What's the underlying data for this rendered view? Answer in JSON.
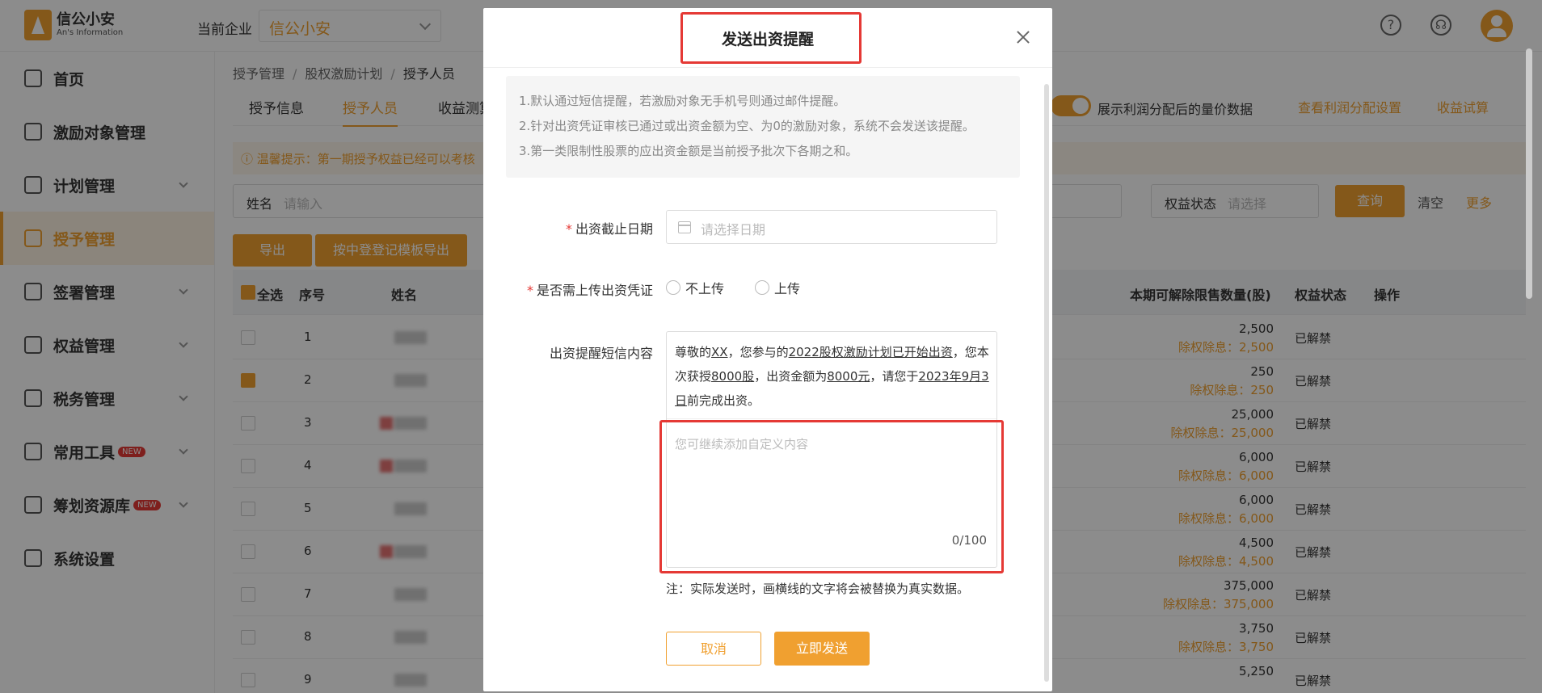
{
  "app": {
    "logo_cn": "信公小安",
    "logo_en": "An's Information",
    "company_label": "当前企业",
    "company_value": "信公小安"
  },
  "sidebar": {
    "items": [
      {
        "label": "首页",
        "icon": "home-icon",
        "has_chevron": false
      },
      {
        "label": "激励对象管理",
        "icon": "users-icon",
        "has_chevron": false
      },
      {
        "label": "计划管理",
        "icon": "grid-icon",
        "has_chevron": true
      },
      {
        "label": "授予管理",
        "icon": "list-icon",
        "has_chevron": false,
        "active": true
      },
      {
        "label": "签署管理",
        "icon": "sign-icon",
        "has_chevron": true
      },
      {
        "label": "权益管理",
        "icon": "badge-icon",
        "has_chevron": true
      },
      {
        "label": "税务管理",
        "icon": "tax-icon",
        "has_chevron": true
      },
      {
        "label": "常用工具",
        "icon": "layers-icon",
        "has_chevron": true,
        "badge": "NEW"
      },
      {
        "label": "筹划资源库",
        "icon": "briefcase-icon",
        "has_chevron": true,
        "badge": "NEW"
      },
      {
        "label": "系统设置",
        "icon": "settings-icon",
        "has_chevron": false
      }
    ]
  },
  "main": {
    "breadcrumb": [
      "授予管理",
      "股权激励计划",
      "授予人员"
    ],
    "tabs": [
      "授予信息",
      "授予人员",
      "收益测算"
    ],
    "toggle_label": "展示利润分配后的量价数据",
    "link_profit": "查看利润分配设置",
    "link_trial": "收益试算",
    "tip": "ⓘ 温馨提示：第一期授予权益已经可以考核",
    "filter_name_label": "姓名",
    "filter_name_ph": "请输入",
    "filter_status_label": "权益状态",
    "filter_status_ph": "请选择",
    "btn_query": "查询",
    "btn_clear": "清空",
    "btn_more": "更多",
    "btn_export": "导出",
    "btn_export_template": "按中登登记模板导出",
    "table_headers": {
      "select_all": "全选",
      "index": "序号",
      "name": "姓名",
      "qty": "本期可解除限售数量(股)",
      "status": "权益状态",
      "action": "操作"
    },
    "rows": [
      {
        "index": "1",
        "qty": "2,500",
        "sub": "除权除息：2,500",
        "status": "已解禁",
        "checked": false,
        "red": false
      },
      {
        "index": "2",
        "qty": "250",
        "sub": "除权除息：250",
        "status": "已解禁",
        "checked": true,
        "red": false
      },
      {
        "index": "3",
        "qty": "25,000",
        "sub": "除权除息：25,000",
        "status": "已解禁",
        "checked": false,
        "red": true
      },
      {
        "index": "4",
        "qty": "6,000",
        "sub": "除权除息：6,000",
        "status": "已解禁",
        "checked": false,
        "red": true
      },
      {
        "index": "5",
        "qty": "6,000",
        "sub": "除权除息：6,000",
        "status": "已解禁",
        "checked": false,
        "red": false
      },
      {
        "index": "6",
        "qty": "4,500",
        "sub": "除权除息：4,500",
        "status": "已解禁",
        "checked": false,
        "red": true
      },
      {
        "index": "7",
        "qty": "375,000",
        "sub": "除权除息：375,000",
        "status": "已解禁",
        "checked": false,
        "red": false
      },
      {
        "index": "8",
        "qty": "3,750",
        "sub": "除权除息：3,750",
        "status": "已解禁",
        "checked": false,
        "red": false
      },
      {
        "index": "9",
        "qty": "5,250",
        "sub": "",
        "status": "已解禁",
        "checked": false,
        "red": false
      }
    ]
  },
  "modal": {
    "title": "发送出资提醒",
    "notices": [
      "1.默认通过短信提醒，若激励对象无手机号则通过邮件提醒。",
      "2.针对出资凭证审核已通过或出资金额为空、为0的激励对象，系统不会发送该提醒。",
      "3.第一类限制性股票的应出资金额是当前授予批次下各期之和。"
    ],
    "deadline_label": "出资截止日期",
    "deadline_ph": "请选择日期",
    "upload_label": "是否需上传出资凭证",
    "upload_options": [
      "不上传",
      "上传"
    ],
    "sms_label": "出资提醒短信内容",
    "sms_parts": {
      "p1": "尊敬的",
      "u1": "XX",
      "p2": "，您参与的",
      "u2": "2022股权激励计划已开始出资",
      "p3": "，您本次获授",
      "u3": "8000股",
      "p4": "，出资金额为",
      "u4": "8000元",
      "p5": "，请您于",
      "u5": "2023年9月3日",
      "p6": "前完成出资。"
    },
    "custom_ph": "您可继续添加自定义内容",
    "counter": "0/100",
    "note": "注：实际发送时，画横线的文字将会被替换为真实数据。",
    "btn_cancel": "取消",
    "btn_send": "立即发送"
  },
  "colors": {
    "accent": "#f0a030",
    "highlight": "#e53935"
  }
}
